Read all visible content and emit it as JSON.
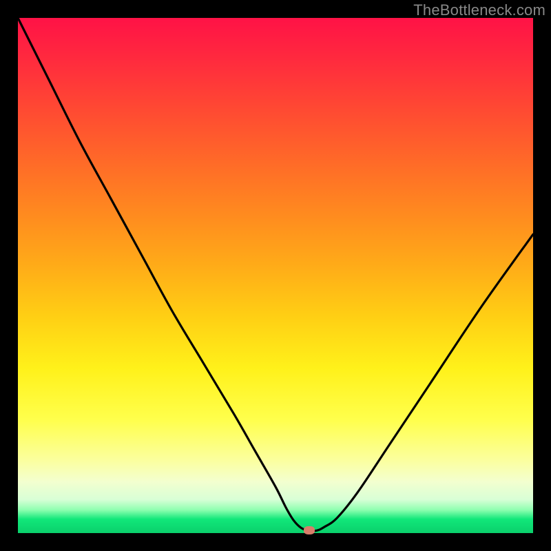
{
  "watermark": "TheBottleneck.com",
  "chart_data": {
    "type": "line",
    "title": "",
    "xlabel": "",
    "ylabel": "",
    "xlim": [
      0,
      100
    ],
    "ylim": [
      0,
      100
    ],
    "grid": false,
    "legend": false,
    "background_gradient": {
      "direction": "vertical",
      "stops": [
        {
          "pos": 0,
          "color": "#ff1246"
        },
        {
          "pos": 38,
          "color": "#ff8a1f"
        },
        {
          "pos": 68,
          "color": "#fff11a"
        },
        {
          "pos": 90,
          "color": "#f3ffcf"
        },
        {
          "pos": 97,
          "color": "#11e77a"
        },
        {
          "pos": 100,
          "color": "#0ad06b"
        }
      ]
    },
    "series": [
      {
        "name": "curve",
        "color": "#000000",
        "x": [
          0,
          6,
          12,
          18,
          24,
          30,
          36,
          42,
          46,
          50,
          52,
          53.5,
          55,
          56.5,
          58,
          59.5,
          62,
          66,
          72,
          80,
          90,
          100
        ],
        "y": [
          100,
          88,
          76,
          65,
          54,
          43,
          33,
          23,
          16,
          9,
          5,
          2.5,
          1,
          0.5,
          0.5,
          1.2,
          3,
          8,
          17,
          29,
          44,
          58
        ]
      }
    ],
    "annotations": [
      {
        "name": "marker",
        "color": "#d97d6a",
        "x": 56.5,
        "y": 0.5
      }
    ]
  }
}
